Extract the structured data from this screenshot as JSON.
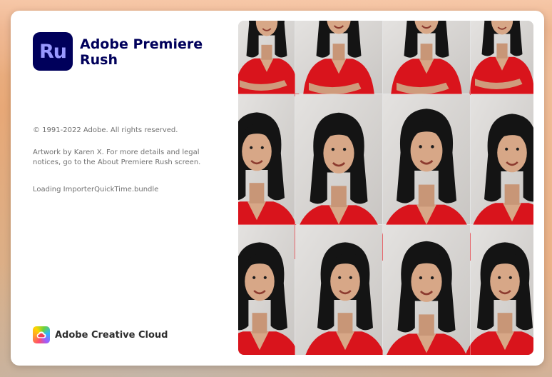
{
  "app": {
    "logo_text": "Ru",
    "title_line1": "Adobe Premiere",
    "title_line2": "Rush"
  },
  "info": {
    "copyright": "© 1991-2022 Adobe. All rights reserved.",
    "artwork": "Artwork by Karen X. For more details and legal notices, go to the About Premiere Rush screen.",
    "loading": "Loading ImporterQuickTime.bundle"
  },
  "footer": {
    "brand": "Adobe Creative Cloud"
  },
  "colors": {
    "brand_bg": "#00005b",
    "brand_text": "#9999ff",
    "shirt": "#d9141c",
    "hair": "#141414",
    "skin": "#d7a787",
    "backdrop": "#d9d7d5"
  },
  "icons": {
    "app_logo": "premiere-rush-logo",
    "footer_icon": "creative-cloud-icon"
  }
}
